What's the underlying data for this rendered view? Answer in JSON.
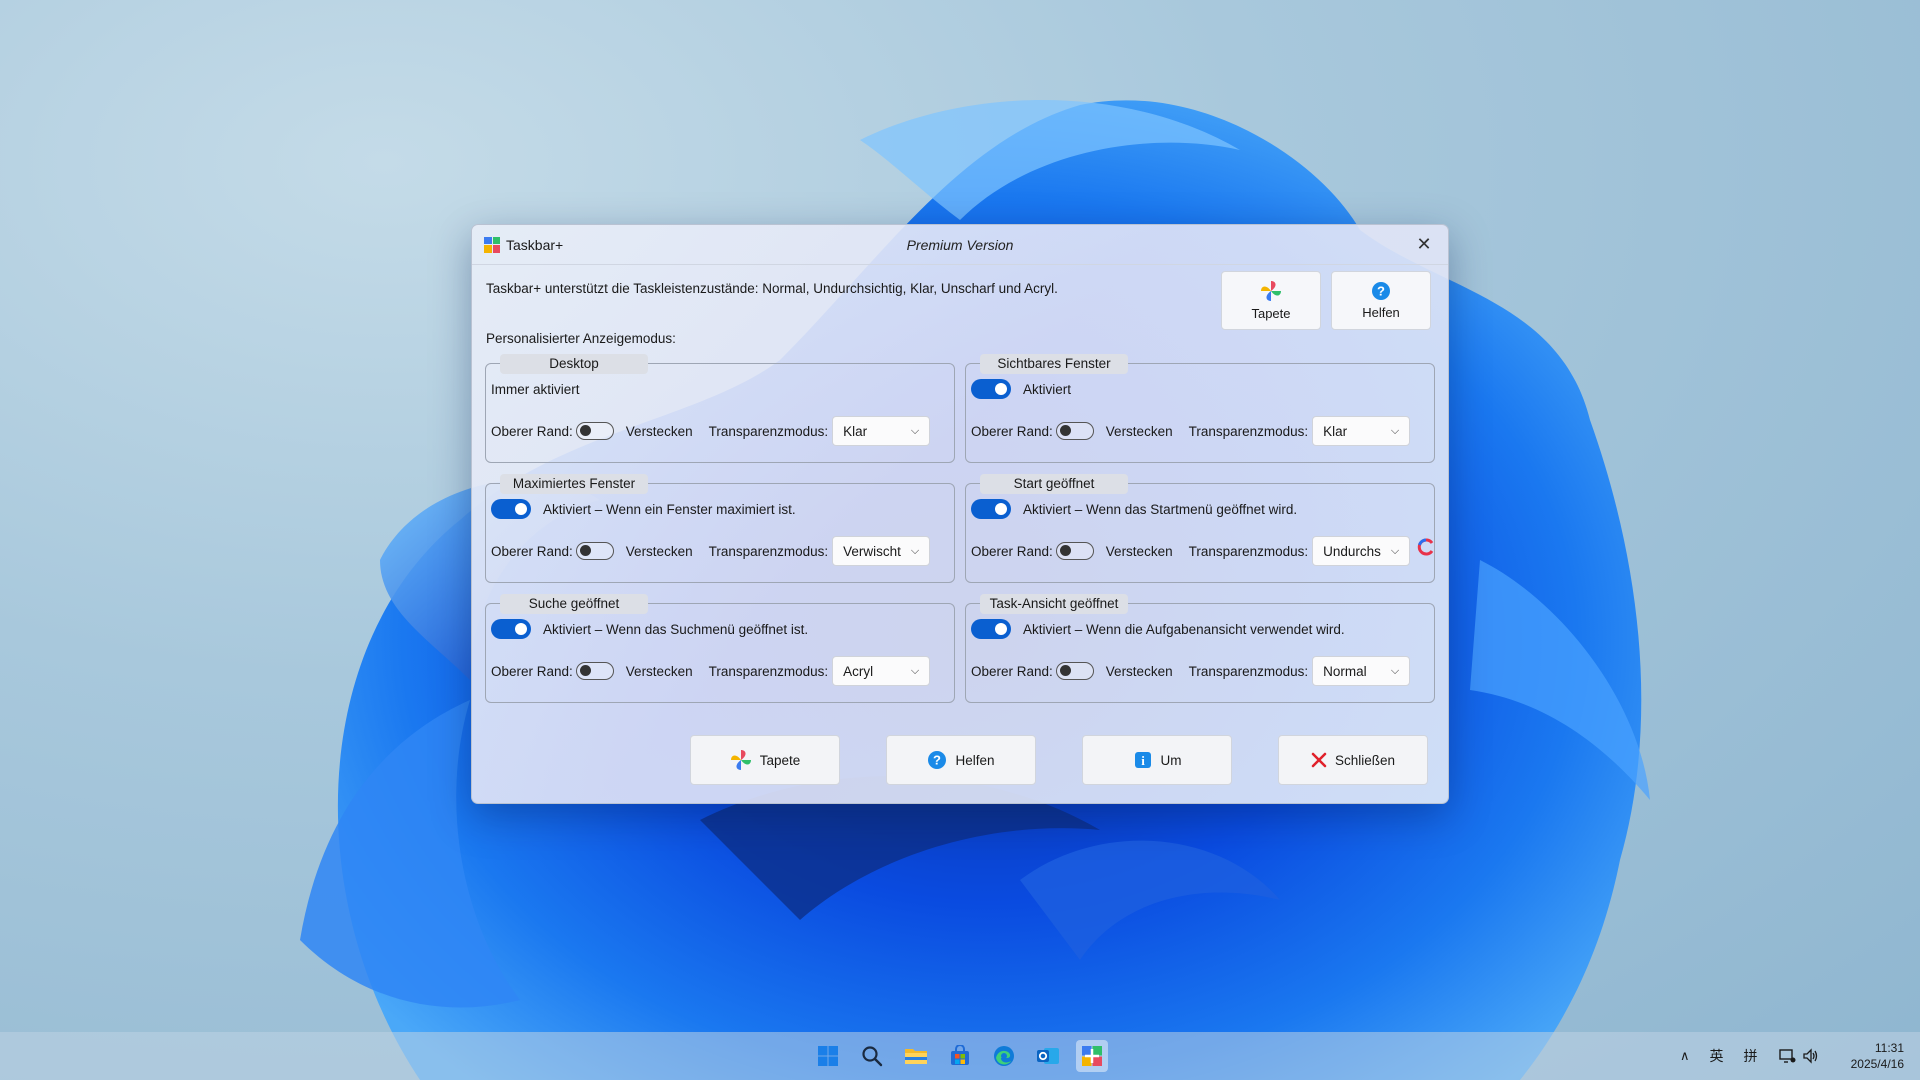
{
  "window": {
    "title": "Taskbar+",
    "subtitle": "Premium Version",
    "intro": "Taskbar+ unterstützt die Taskleistenzustände: Normal, Undurchsichtig, Klar, Unscharf und Acryl.",
    "mode_label": "Personalisierter Anzeigemodus:"
  },
  "top_buttons": {
    "tapete": "Tapete",
    "helfen": "Helfen"
  },
  "common": {
    "top_edge": "Oberer Rand:",
    "hide": "Verstecken",
    "transparency": "Transparenzmodus:"
  },
  "groups": {
    "desktop": {
      "title": "Desktop",
      "status": "Immer aktiviert",
      "mode": "Klar"
    },
    "visible": {
      "title": "Sichtbares Fenster",
      "status": "Aktiviert",
      "mode": "Klar"
    },
    "maximized": {
      "title": "Maximiertes Fenster",
      "status": "Aktiviert – Wenn ein Fenster maximiert ist.",
      "mode": "Verwischt"
    },
    "start": {
      "title": "Start geöffnet",
      "status": "Aktiviert – Wenn das Startmenü geöffnet wird.",
      "mode": "Undurchsichtig"
    },
    "search": {
      "title": "Suche geöffnet",
      "status": "Aktiviert – Wenn das Suchmenü geöffnet ist.",
      "mode": "Acryl"
    },
    "taskview": {
      "title": "Task-Ansicht geöffnet",
      "status": "Aktiviert – Wenn die Aufgabenansicht verwendet wird.",
      "mode": "Normal"
    }
  },
  "bottom_buttons": {
    "tapete": "Tapete",
    "helfen": "Helfen",
    "um": "Um",
    "close": "Schließen"
  },
  "taskbar": {
    "tray_ime1": "英",
    "tray_ime2": "拼",
    "time": "11:31",
    "date": "2025/4/16"
  }
}
